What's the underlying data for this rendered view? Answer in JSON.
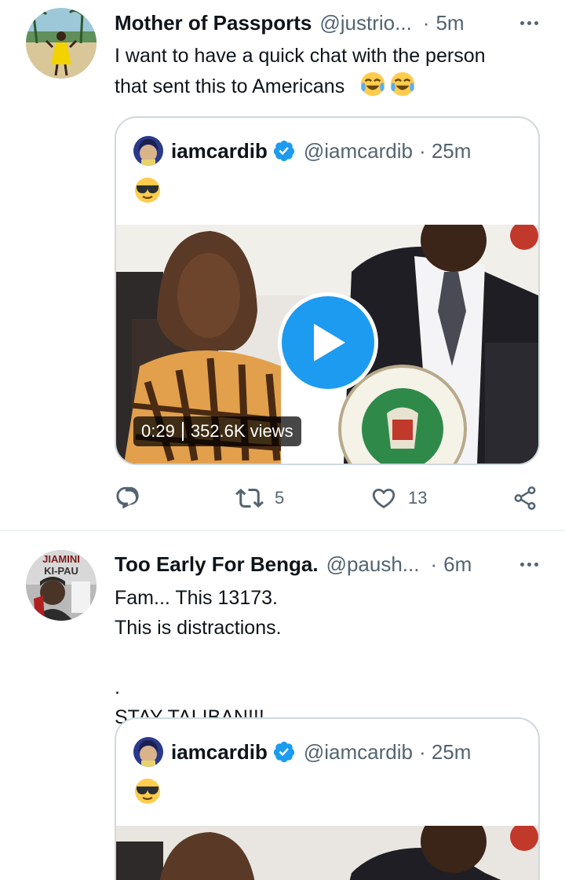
{
  "tweets": [
    {
      "author_name": "Mother of Passports",
      "handle": "@justrio...",
      "separator": "·",
      "time": "5m",
      "text_lines": [
        "I want to have a quick chat with the person",
        "that sent this to Americans"
      ],
      "quoted": {
        "author_name": "iamcardib",
        "handle": "@iamcardib",
        "separator": "·",
        "time": "25m",
        "video_duration": "0:29",
        "video_views": "352.6K views"
      },
      "actions": {
        "reply_count": "",
        "retweet_count": "5",
        "like_count": "13"
      }
    },
    {
      "author_name": "Too Early For Benga.",
      "handle": "@paush...",
      "separator": "·",
      "time": "6m",
      "text_lines": [
        "Fam... This 13173.",
        "This is distractions.",
        "",
        ".",
        "STAY TALIBAN!!!"
      ],
      "avatar_text": [
        "JIAMINI",
        "KI-PAU"
      ],
      "quoted": {
        "author_name": "iamcardib",
        "handle": "@iamcardib",
        "separator": "·",
        "time": "25m"
      }
    }
  ],
  "icons": [
    "more-icon",
    "verified-badge-icon",
    "play-icon",
    "reply-icon",
    "retweet-icon",
    "like-icon",
    "share-icon",
    "face-with-tears-of-joy-emoji",
    "sunglasses-emoji"
  ],
  "colors": {
    "accent": "#1d9bf0",
    "text": "#0f1419",
    "secondary": "#536471",
    "border": "#cfd9de"
  }
}
